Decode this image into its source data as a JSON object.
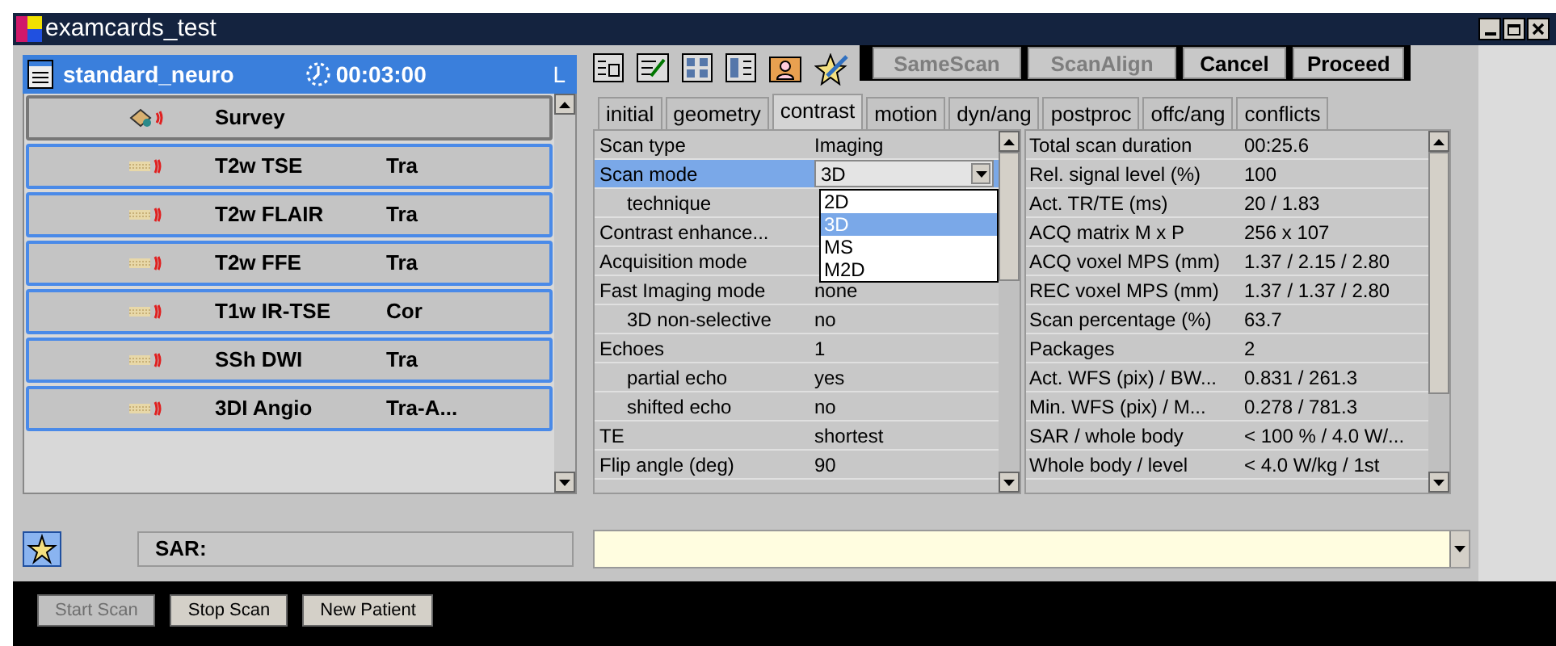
{
  "window": {
    "title": "examcards_test"
  },
  "exam_card": {
    "name": "standard_neuro",
    "duration": "00:03:00",
    "side": "L"
  },
  "scans": [
    {
      "kind": "survey",
      "name": "Survey",
      "selected": true
    },
    {
      "kind": "scan",
      "name": "T2w TSE",
      "orientation": "Tra",
      "selected": false
    },
    {
      "kind": "scan",
      "name": "T2w FLAIR",
      "orientation": "Tra",
      "selected": false
    },
    {
      "kind": "scan",
      "name": "T2w FFE",
      "orientation": "Tra",
      "selected": false
    },
    {
      "kind": "scan",
      "name": "T1w IR-TSE",
      "orientation": "Cor",
      "selected": false
    },
    {
      "kind": "scan",
      "name": "SSh DWI",
      "orientation": "Tra",
      "selected": false
    },
    {
      "kind": "scan",
      "name": "3DI Angio",
      "orientation": "Tra-A...",
      "selected": false
    }
  ],
  "sar": {
    "label": "SAR:"
  },
  "action_buttons": [
    {
      "label": "SameScan",
      "disabled": true
    },
    {
      "label": "ScanAlign",
      "disabled": true
    },
    {
      "label": "Cancel",
      "disabled": false
    },
    {
      "label": "Proceed",
      "disabled": false
    }
  ],
  "tabs": [
    {
      "label": "initial",
      "selected": false
    },
    {
      "label": "geometry",
      "selected": false
    },
    {
      "label": "contrast",
      "selected": true
    },
    {
      "label": "motion",
      "selected": false
    },
    {
      "label": "dyn/ang",
      "selected": false
    },
    {
      "label": "postproc",
      "selected": false
    },
    {
      "label": "offc/ang",
      "selected": false
    },
    {
      "label": "conflicts",
      "selected": false
    }
  ],
  "parameters": [
    {
      "label": "Scan type",
      "value": "Imaging",
      "selected": false
    },
    {
      "label": "Scan mode",
      "value": "3D",
      "selected": true,
      "kind": "dropdown",
      "children": [
        {
          "label": "technique",
          "selected": false
        }
      ]
    },
    {
      "label": "Contrast enhance...",
      "selected": false
    },
    {
      "label": "Acquisition mode",
      "selected": false
    },
    {
      "label": "Fast Imaging mode",
      "value": "none",
      "selected": false,
      "children": [
        {
          "label": "3D non-selective",
          "value": "no",
          "selected": false
        }
      ]
    },
    {
      "label": "Echoes",
      "value": "1",
      "selected": false,
      "children": [
        {
          "label": "partial echo",
          "value": "yes",
          "selected": false
        },
        {
          "label": "shifted echo",
          "value": "no",
          "selected": false
        }
      ]
    },
    {
      "label": "TE",
      "value": "shortest",
      "selected": false
    },
    {
      "label": "Flip angle (deg)",
      "value": "90",
      "selected": false
    }
  ],
  "dropdown_options": [
    {
      "label": "2D",
      "selected": false
    },
    {
      "label": "3D",
      "selected": true
    },
    {
      "label": "MS",
      "selected": false
    },
    {
      "label": "M2D",
      "selected": false
    }
  ],
  "info": [
    {
      "label": "Total scan duration",
      "value": "00:25.6"
    },
    {
      "label": "Rel. signal level (%)",
      "value": "100"
    },
    {
      "label": "Act. TR/TE (ms)",
      "value": "20 / 1.83"
    },
    {
      "label": "ACQ matrix M x P",
      "value": "256 x 107"
    },
    {
      "label": "ACQ voxel MPS (mm)",
      "value": "1.37 / 2.15 / 2.80"
    },
    {
      "label": "REC voxel MPS (mm)",
      "value": "1.37 / 1.37 / 2.80"
    },
    {
      "label": "Scan percentage (%)",
      "value": "63.7"
    },
    {
      "label": "Packages",
      "value": "2"
    },
    {
      "label": "Act. WFS (pix) / BW...",
      "value": "0.831 / 261.3"
    },
    {
      "label": "Min. WFS (pix) / M...",
      "value": "0.278 / 781.3"
    },
    {
      "label": "SAR / whole body",
      "value": "< 100 % / 4.0 W/..."
    },
    {
      "label": "Whole body / level",
      "value": "< 4.0 W/kg / 1st"
    }
  ],
  "bottom_buttons": [
    {
      "label": "Start Scan",
      "disabled": true
    },
    {
      "label": "Stop Scan",
      "disabled": false
    },
    {
      "label": "New Patient",
      "disabled": false
    }
  ]
}
